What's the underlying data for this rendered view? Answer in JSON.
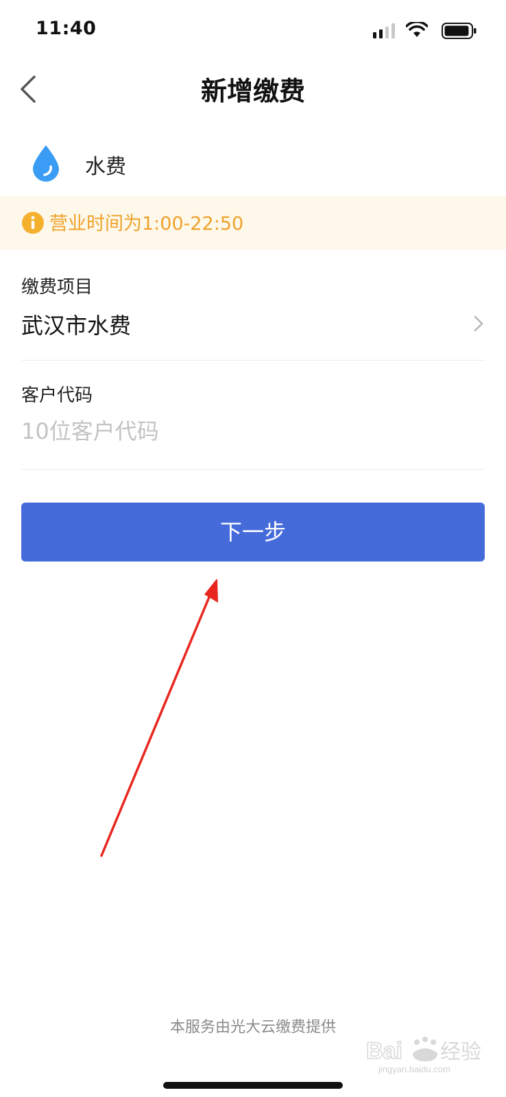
{
  "status_bar": {
    "time": "11:40",
    "icons": [
      "signal-icon",
      "wifi-icon",
      "battery-icon"
    ]
  },
  "nav": {
    "back_icon": "chevron-left-icon",
    "title": "新增缴费"
  },
  "category": {
    "icon": "water-drop-icon",
    "label": "水费",
    "icon_color": "#3a9cf5"
  },
  "notice": {
    "icon": "info-icon",
    "text": "营业时间为1:00-22:50",
    "color": "#f0a22a",
    "background": "#fdf8ea"
  },
  "form": {
    "project": {
      "label": "缴费项目",
      "value": "武汉市水费",
      "icon": "chevron-right-icon"
    },
    "customer_code": {
      "label": "客户代码",
      "value": "",
      "placeholder": "10位客户代码"
    }
  },
  "next_button": {
    "label": "下一步",
    "color": "#456bdb"
  },
  "annotation": {
    "icon": "red-arrow-icon",
    "color": "#e8261e"
  },
  "footer": {
    "text": "本服务由光大云缴费提供"
  },
  "watermark": {
    "text": "Baidu经验",
    "subtext": "jingyan.baidu.com"
  }
}
